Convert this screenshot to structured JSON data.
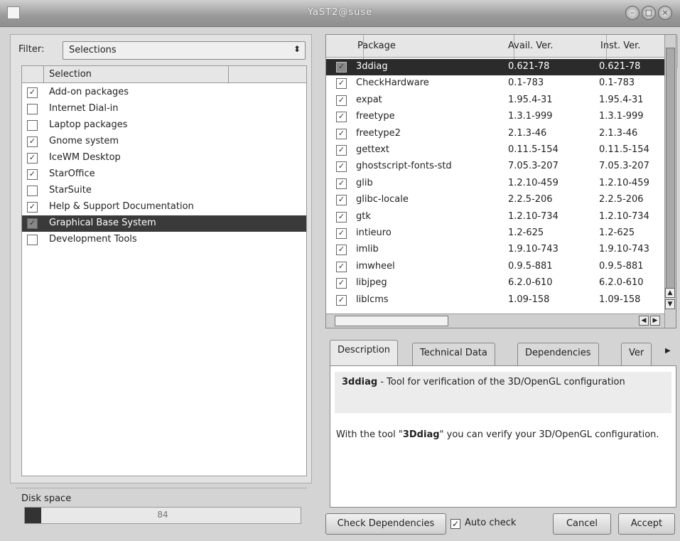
{
  "window": {
    "title": "YaST2@suse"
  },
  "filter": {
    "label": "Filter:",
    "value": "Selections"
  },
  "selections": {
    "header": "Selection",
    "items": [
      {
        "label": "Add-on packages",
        "checked": true
      },
      {
        "label": "Internet Dial-in",
        "checked": false
      },
      {
        "label": "Laptop packages",
        "checked": false
      },
      {
        "label": "Gnome system",
        "checked": true
      },
      {
        "label": "IceWM Desktop",
        "checked": true
      },
      {
        "label": "StarOffice",
        "checked": true
      },
      {
        "label": "StarSuite",
        "checked": false
      },
      {
        "label": "Help & Support Documentation",
        "checked": true
      },
      {
        "label": "Graphical Base System",
        "checked": true,
        "selected": true
      },
      {
        "label": "Development Tools",
        "checked": false
      }
    ]
  },
  "disk": {
    "label": "Disk space",
    "value": "84",
    "fill_fraction": 0.06
  },
  "packages": {
    "columns": [
      "Package",
      "Avail. Ver.",
      "Inst. Ver."
    ],
    "rows": [
      {
        "name": "3ddiag",
        "avail": "0.621-78",
        "inst": "0.621-78",
        "selected": true
      },
      {
        "name": "CheckHardware",
        "avail": "0.1-783",
        "inst": "0.1-783"
      },
      {
        "name": "expat",
        "avail": "1.95.4-31",
        "inst": "1.95.4-31"
      },
      {
        "name": "freetype",
        "avail": "1.3.1-999",
        "inst": "1.3.1-999"
      },
      {
        "name": "freetype2",
        "avail": "2.1.3-46",
        "inst": "2.1.3-46"
      },
      {
        "name": "gettext",
        "avail": "0.11.5-154",
        "inst": "0.11.5-154"
      },
      {
        "name": "ghostscript-fonts-std",
        "avail": "7.05.3-207",
        "inst": "7.05.3-207"
      },
      {
        "name": "glib",
        "avail": "1.2.10-459",
        "inst": "1.2.10-459"
      },
      {
        "name": "glibc-locale",
        "avail": "2.2.5-206",
        "inst": "2.2.5-206"
      },
      {
        "name": "gtk",
        "avail": "1.2.10-734",
        "inst": "1.2.10-734"
      },
      {
        "name": "intieuro",
        "avail": "1.2-625",
        "inst": "1.2-625"
      },
      {
        "name": "imlib",
        "avail": "1.9.10-743",
        "inst": "1.9.10-743"
      },
      {
        "name": "imwheel",
        "avail": "0.9.5-881",
        "inst": "0.9.5-881"
      },
      {
        "name": "libjpeg",
        "avail": "6.2.0-610",
        "inst": "6.2.0-610"
      },
      {
        "name": "liblcms",
        "avail": "1.09-158",
        "inst": "1.09-158"
      }
    ]
  },
  "tabs": [
    "Description",
    "Technical Data",
    "Dependencies",
    "Ver"
  ],
  "description": {
    "package": "3ddiag",
    "summary": " - Tool for verification of the 3D/OpenGL configuration",
    "body_prefix": "With the tool \"",
    "body_pkg": "3Ddiag",
    "body_suffix": "\" you can verify your 3D/OpenGL configuration."
  },
  "buttons": {
    "check_dependencies": "Check Dependencies",
    "auto_check": "Auto check",
    "cancel": "Cancel",
    "accept": "Accept"
  }
}
